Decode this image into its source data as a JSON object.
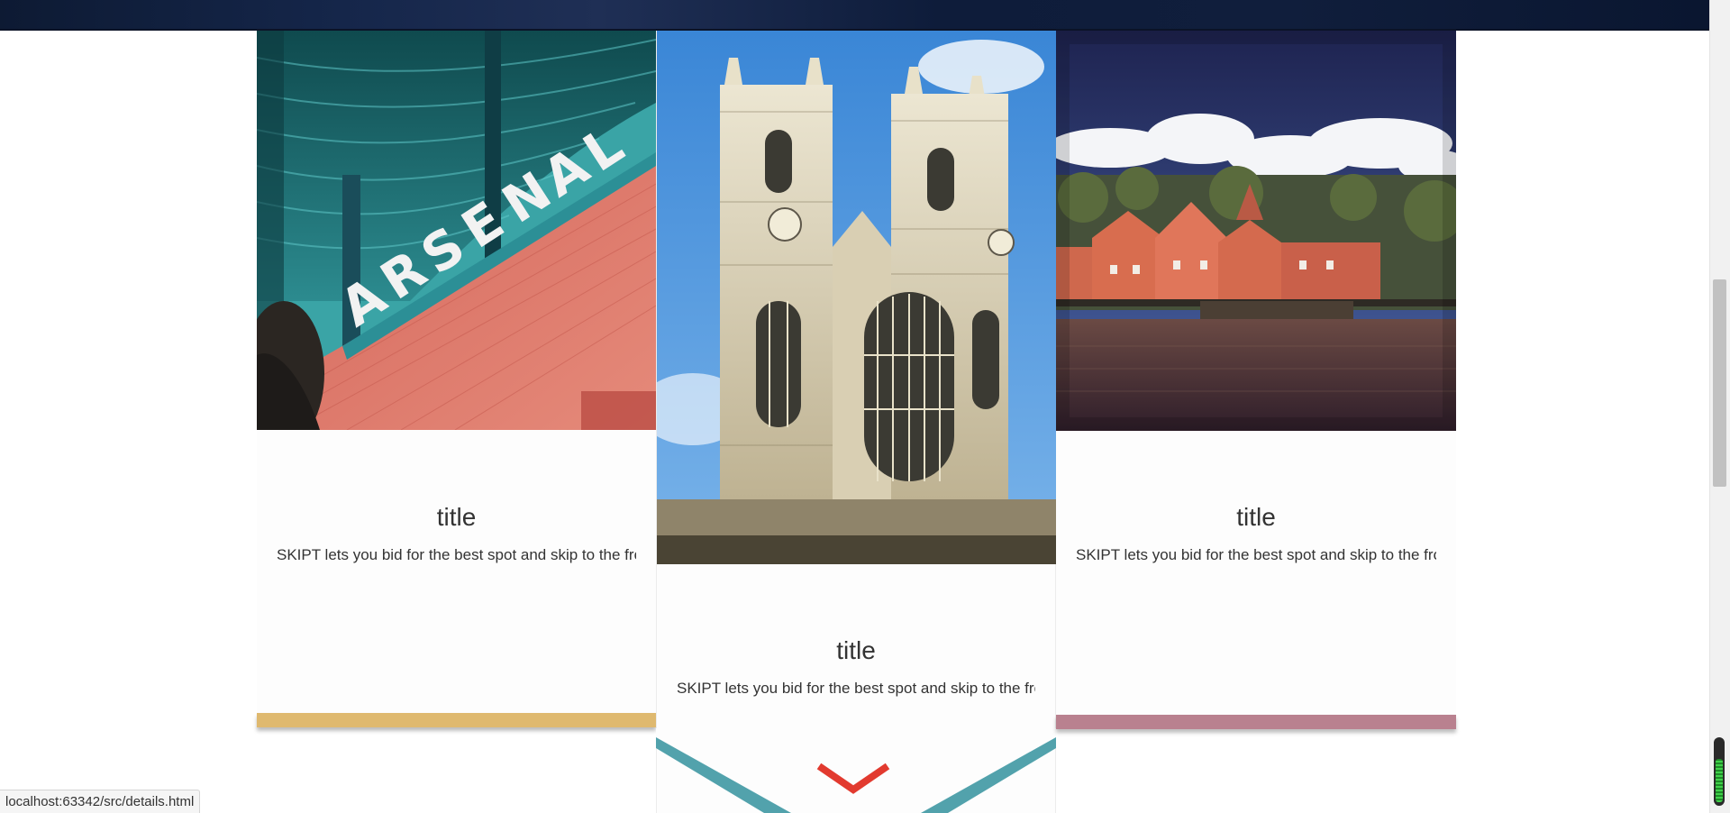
{
  "cards": [
    {
      "title": "title",
      "description": "SKIPT lets you bid for the best spot and skip to the front",
      "image": "arsenal-stadium-photo",
      "bar_color": "#dfb96f"
    },
    {
      "title": "title",
      "description": "SKIPT lets you bid for the best spot and skip to the front",
      "image": "cathedral-photo",
      "bar_color": "#52a2ac"
    },
    {
      "title": "title",
      "description": "SKIPT lets you bid for the best spot and skip to the front",
      "image": "harbor-town-photo",
      "bar_color": "#b9818f"
    }
  ],
  "scroll_indicator": {
    "icon": "chevron-down-icon",
    "color": "#e23a2f"
  },
  "status_bar": {
    "url": "localhost:63342/src/details.html"
  }
}
